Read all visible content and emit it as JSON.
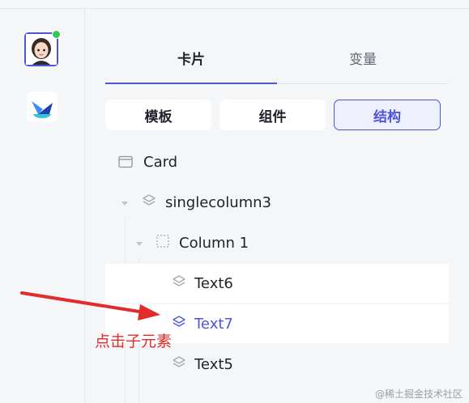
{
  "tabs": {
    "active_label": "卡片",
    "inactive_label": "变量"
  },
  "segments": {
    "template": "模板",
    "component": "组件",
    "structure": "结构"
  },
  "tree": {
    "card": "Card",
    "singlecolumn": "singlecolumn3",
    "column": "Column 1",
    "text6": "Text6",
    "text7": "Text7",
    "text5": "Text5"
  },
  "annotation": {
    "text": "点击子元素"
  },
  "watermark": "@稀土掘金技术社区",
  "colors": {
    "accent": "#4e55d9",
    "annotation_red": "#e22b2b",
    "online_green": "#34c759"
  }
}
